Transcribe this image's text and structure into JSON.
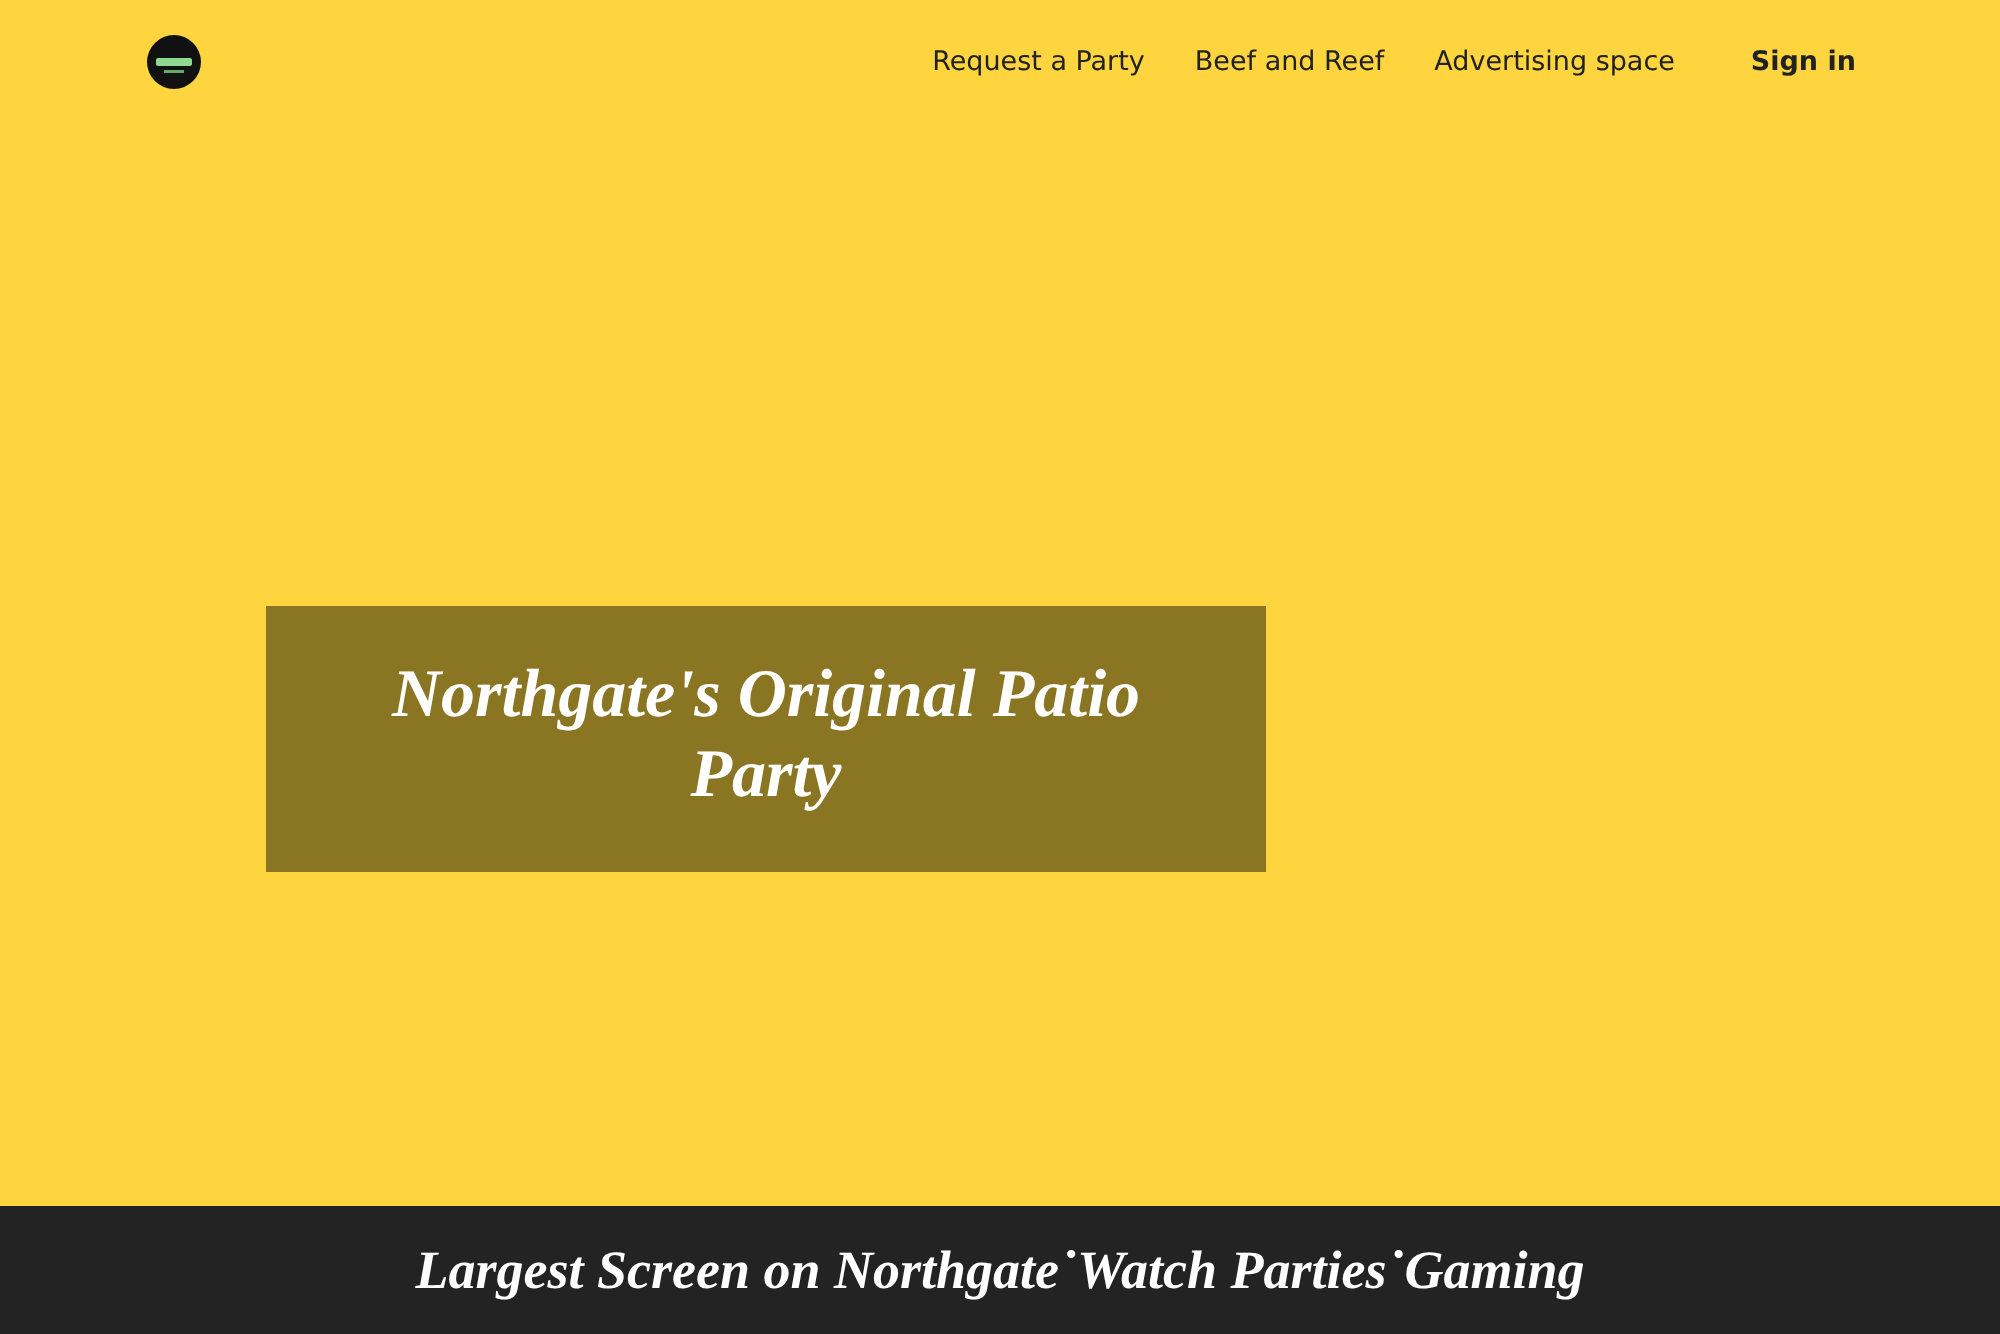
{
  "header": {
    "nav": [
      {
        "label": "Request a Party"
      },
      {
        "label": "Beef and Reef"
      },
      {
        "label": "Advertising space"
      }
    ],
    "sign_in": "Sign in"
  },
  "hero": {
    "title": "Northgate's Original Patio Party"
  },
  "banner": {
    "text": "Largest Screen on Northgate˙Watch Parties˙Gaming"
  }
}
